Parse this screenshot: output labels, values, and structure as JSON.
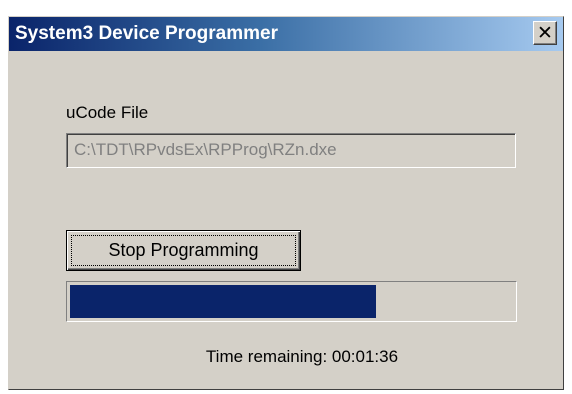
{
  "window": {
    "title": "System3 Device Programmer",
    "close_glyph": "✕",
    "title_color_start": "#0a246a",
    "title_color_end": "#a6caf0"
  },
  "ucode": {
    "label": "uCode File",
    "value": "C:\\TDT\\RPvdsEx\\RPProg\\RZn.dxe"
  },
  "actions": {
    "stop_label": "Stop Programming"
  },
  "progress": {
    "fraction": 0.69,
    "fill_color": "#0a246a"
  },
  "status": {
    "time_label": "Time remaining:",
    "time_value": "00:01:36"
  }
}
